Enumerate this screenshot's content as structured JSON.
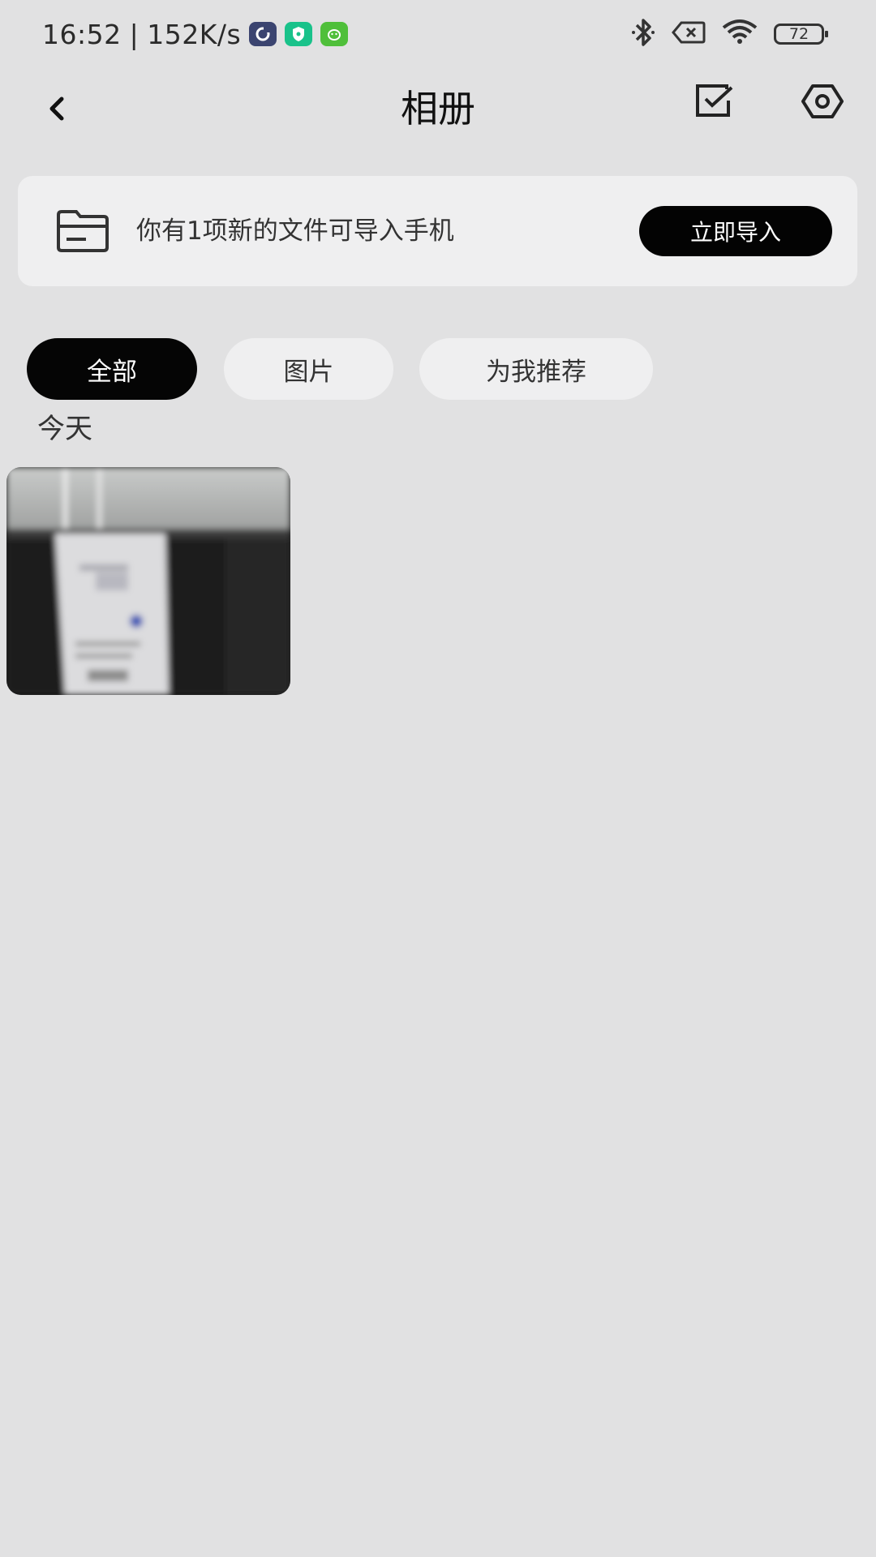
{
  "status_bar": {
    "time": "16:52",
    "separator": "|",
    "net_speed": "152K/s",
    "battery_level": "72",
    "icons": [
      "app-sync-icon",
      "app-shield-icon",
      "app-android-icon",
      "bluetooth-icon",
      "no-sim-icon",
      "wifi-icon",
      "battery-icon"
    ]
  },
  "header": {
    "title": "相册"
  },
  "import_banner": {
    "message": "你有1项新的文件可导入手机",
    "button_label": "立即导入"
  },
  "filters": {
    "all": "全部",
    "images": "图片",
    "recommended": "为我推荐",
    "selected": "全部"
  },
  "gallery": {
    "section_title": "今天",
    "item_count": 1
  },
  "colors": {
    "background": "#e1e1e2",
    "card": "#efeff0",
    "accent": "#050505"
  }
}
